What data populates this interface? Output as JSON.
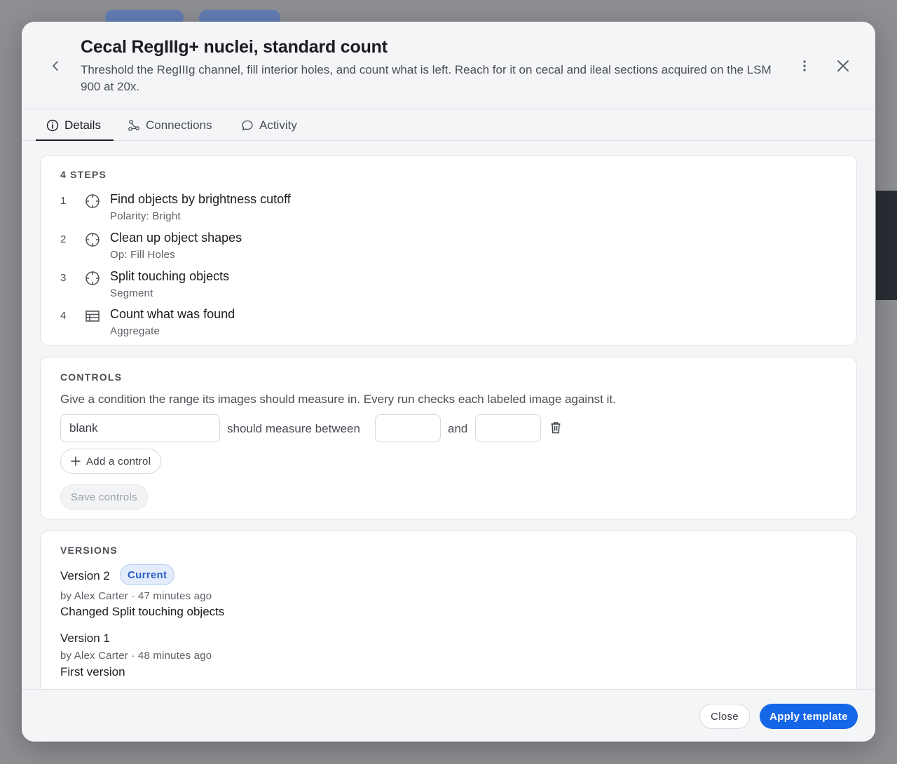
{
  "header": {
    "title": "Cecal RegIIIg+ nuclei, standard count",
    "subtitle": "Threshold the RegIIIg channel, fill interior holes, and count what is left. Reach for it on cecal and ileal sections acquired on the LSM 900 at 20x."
  },
  "tabs": [
    {
      "label": "Details",
      "icon": "info-icon",
      "active": true
    },
    {
      "label": "Connections",
      "icon": "connections-icon",
      "active": false
    },
    {
      "label": "Activity",
      "icon": "chat-bubble-icon",
      "active": false
    }
  ],
  "steps": {
    "label": "4 STEPS",
    "items": [
      {
        "num": "1",
        "title": "Find objects by brightness cutoff",
        "sub": "Polarity: Bright",
        "icon": "crosshair-icon"
      },
      {
        "num": "2",
        "title": "Clean up object shapes",
        "sub": "Op: Fill Holes",
        "icon": "crosshair-icon"
      },
      {
        "num": "3",
        "title": "Split touching objects",
        "sub": "Segment",
        "icon": "crosshair-icon"
      },
      {
        "num": "4",
        "title": "Count what was found",
        "sub": "Aggregate",
        "icon": "table-icon"
      }
    ]
  },
  "controls": {
    "label": "CONTROLS",
    "description": "Give a condition the range its images should measure in. Every run checks each labeled image against it.",
    "condition_value": "blank",
    "between_text": "should measure between",
    "and_text": "and",
    "min_value": "",
    "max_value": "",
    "add_label": "Add a control",
    "save_label": "Save controls"
  },
  "versions": {
    "label": "VERSIONS",
    "items": [
      {
        "title": "Version 2",
        "badge": "Current",
        "meta": "by Alex Carter · 47 minutes ago",
        "desc": "Changed Split touching objects"
      },
      {
        "title": "Version 1",
        "meta": "by Alex Carter · 48 minutes ago",
        "desc": "First version"
      }
    ]
  },
  "footer": {
    "close_label": "Close",
    "apply_label": "Apply template"
  },
  "colors": {
    "accent": "#1667e8",
    "badge_bg": "#e3ecfb",
    "badge_text": "#2a5fc8"
  }
}
